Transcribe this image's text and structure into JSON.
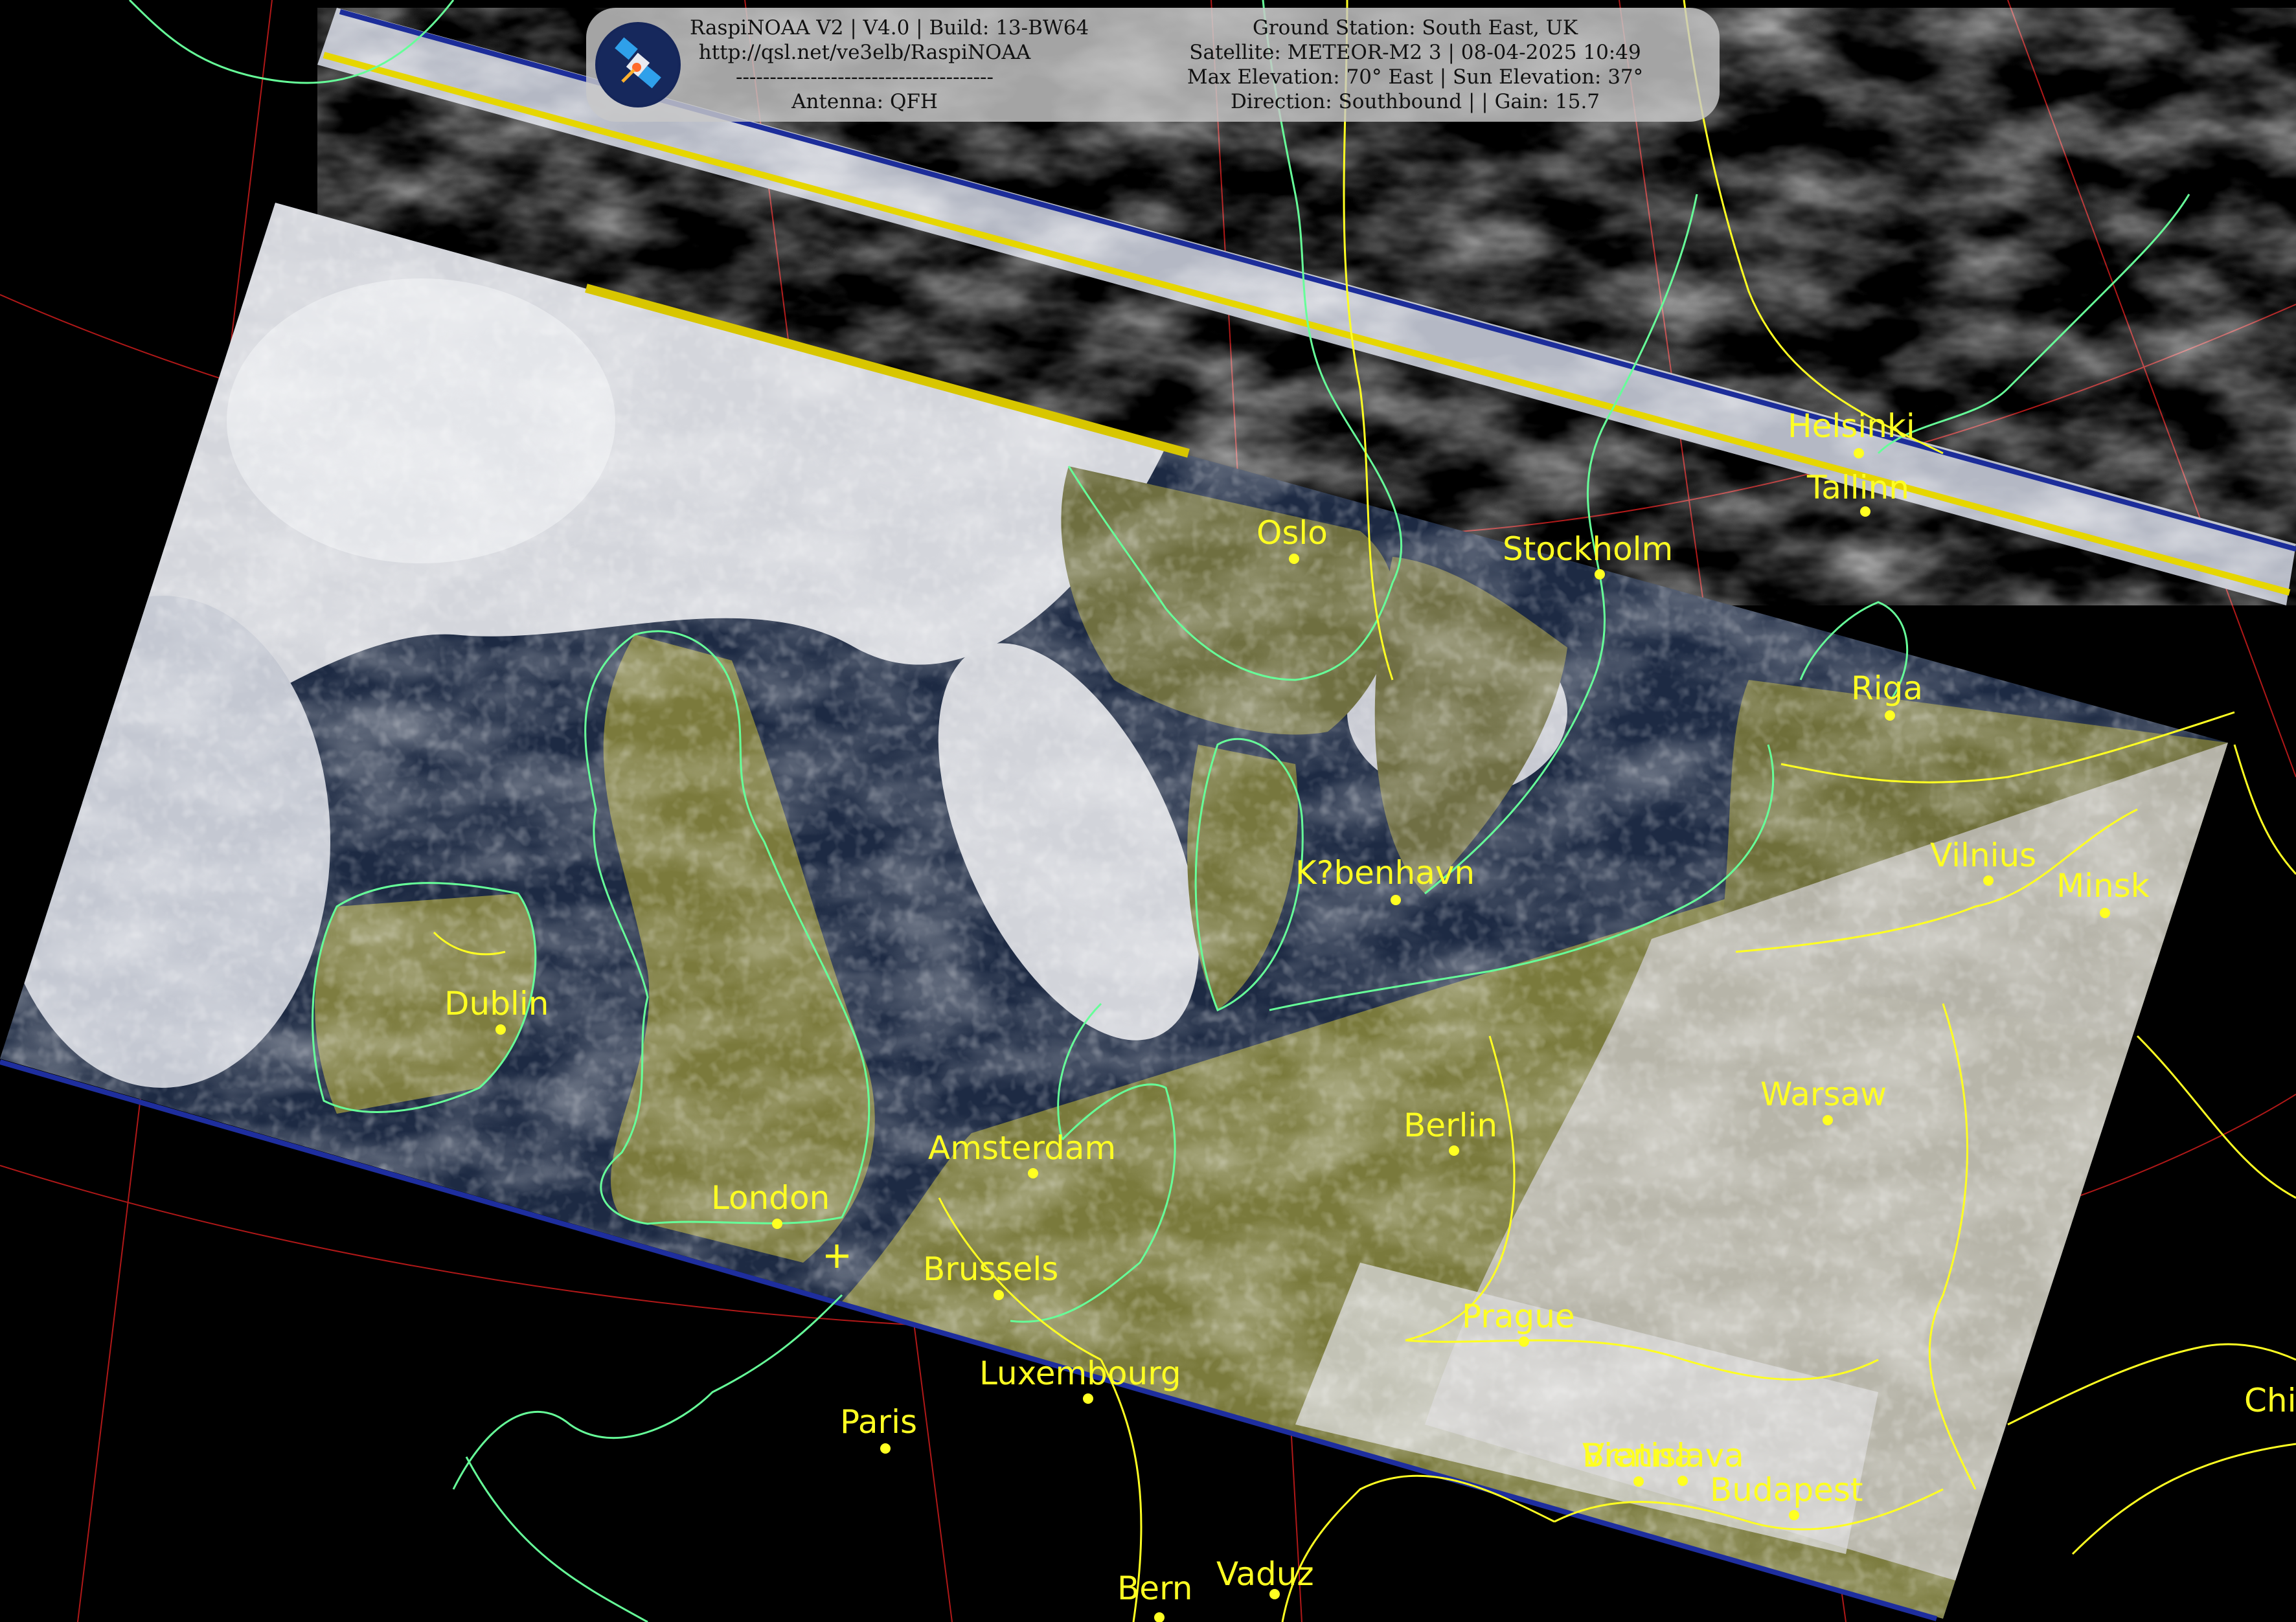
{
  "header": {
    "left_lines": [
      "RaspiNOAA V2 | V4.0 | Build: 13-BW64",
      "http://qsl.net/ve3elb/RaspiNOAA",
      "--------------------------------------",
      "Antenna: QFH"
    ],
    "right_lines": [
      "Ground Station: South East, UK",
      "Satellite: METEOR-M2 3 | 08-04-2025 10:49",
      "Max Elevation: 70° East | Sun Elevation: 37°",
      "Direction: Southbound | | Gain: 15.7"
    ],
    "logo_icon": "satellite-icon"
  },
  "cities": [
    {
      "id": "helsinki",
      "label": "Helsinki"
    },
    {
      "id": "tallinn",
      "label": "Tallinn"
    },
    {
      "id": "oslo",
      "label": "Oslo"
    },
    {
      "id": "stockholm",
      "label": "Stockholm"
    },
    {
      "id": "riga",
      "label": "Riga"
    },
    {
      "id": "vilnius",
      "label": "Vilnius"
    },
    {
      "id": "minsk",
      "label": "Minsk"
    },
    {
      "id": "kobenhavn",
      "label": "K?benhavn"
    },
    {
      "id": "dublin",
      "label": "Dublin"
    },
    {
      "id": "amsterdam",
      "label": "Amsterdam"
    },
    {
      "id": "berlin",
      "label": "Berlin"
    },
    {
      "id": "warsaw",
      "label": "Warsaw"
    },
    {
      "id": "london",
      "label": "London"
    },
    {
      "id": "brussels",
      "label": "Brussels"
    },
    {
      "id": "prague",
      "label": "Prague"
    },
    {
      "id": "luxembourg",
      "label": "Luxembourg"
    },
    {
      "id": "paris",
      "label": "Paris"
    },
    {
      "id": "vienna",
      "label": "Vienna"
    },
    {
      "id": "bratislava",
      "label": "Bratislava"
    },
    {
      "id": "budapest",
      "label": "Budapest"
    },
    {
      "id": "vaduz",
      "label": "Vaduz"
    },
    {
      "id": "bern",
      "label": "Bern"
    },
    {
      "id": "chisinau",
      "label": "Chi"
    }
  ],
  "colors": {
    "coastline": "#66ff99",
    "border": "#ffff22",
    "grid": "#b01818",
    "label": "#ffff22"
  }
}
